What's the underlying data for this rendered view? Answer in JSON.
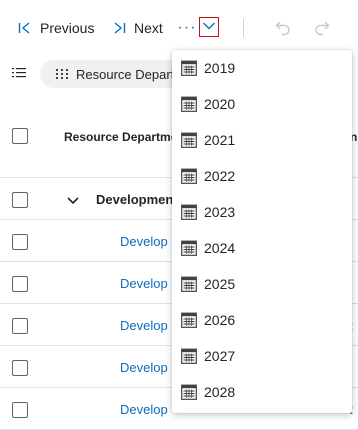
{
  "toolbar": {
    "previous_label": "Previous",
    "next_label": "Next",
    "more_label": "···"
  },
  "filter": {
    "chip_label": "Resource Depart"
  },
  "grid": {
    "header_label": "Resource Departme",
    "group_label": "Development",
    "row_label": "Develop",
    "row_count": 5,
    "edge_glyph": "n",
    "edge_text": "t"
  },
  "menu": {
    "items": [
      "2019",
      "2020",
      "2021",
      "2022",
      "2023",
      "2024",
      "2025",
      "2026",
      "2027",
      "2028"
    ]
  },
  "colors": {
    "accent": "#0f6cbd",
    "focus_border": "#c50f1f",
    "text": "#242424",
    "divider": "#e0e0e0"
  },
  "icons": {
    "previous": "previous-icon",
    "next": "next-icon",
    "dropdown": "chevron-down-icon",
    "undo": "undo-icon",
    "redo": "redo-icon",
    "list": "list-icon",
    "chip": "grid-icon",
    "menu_item": "calendar-icon",
    "group": "chevron-down-icon"
  }
}
